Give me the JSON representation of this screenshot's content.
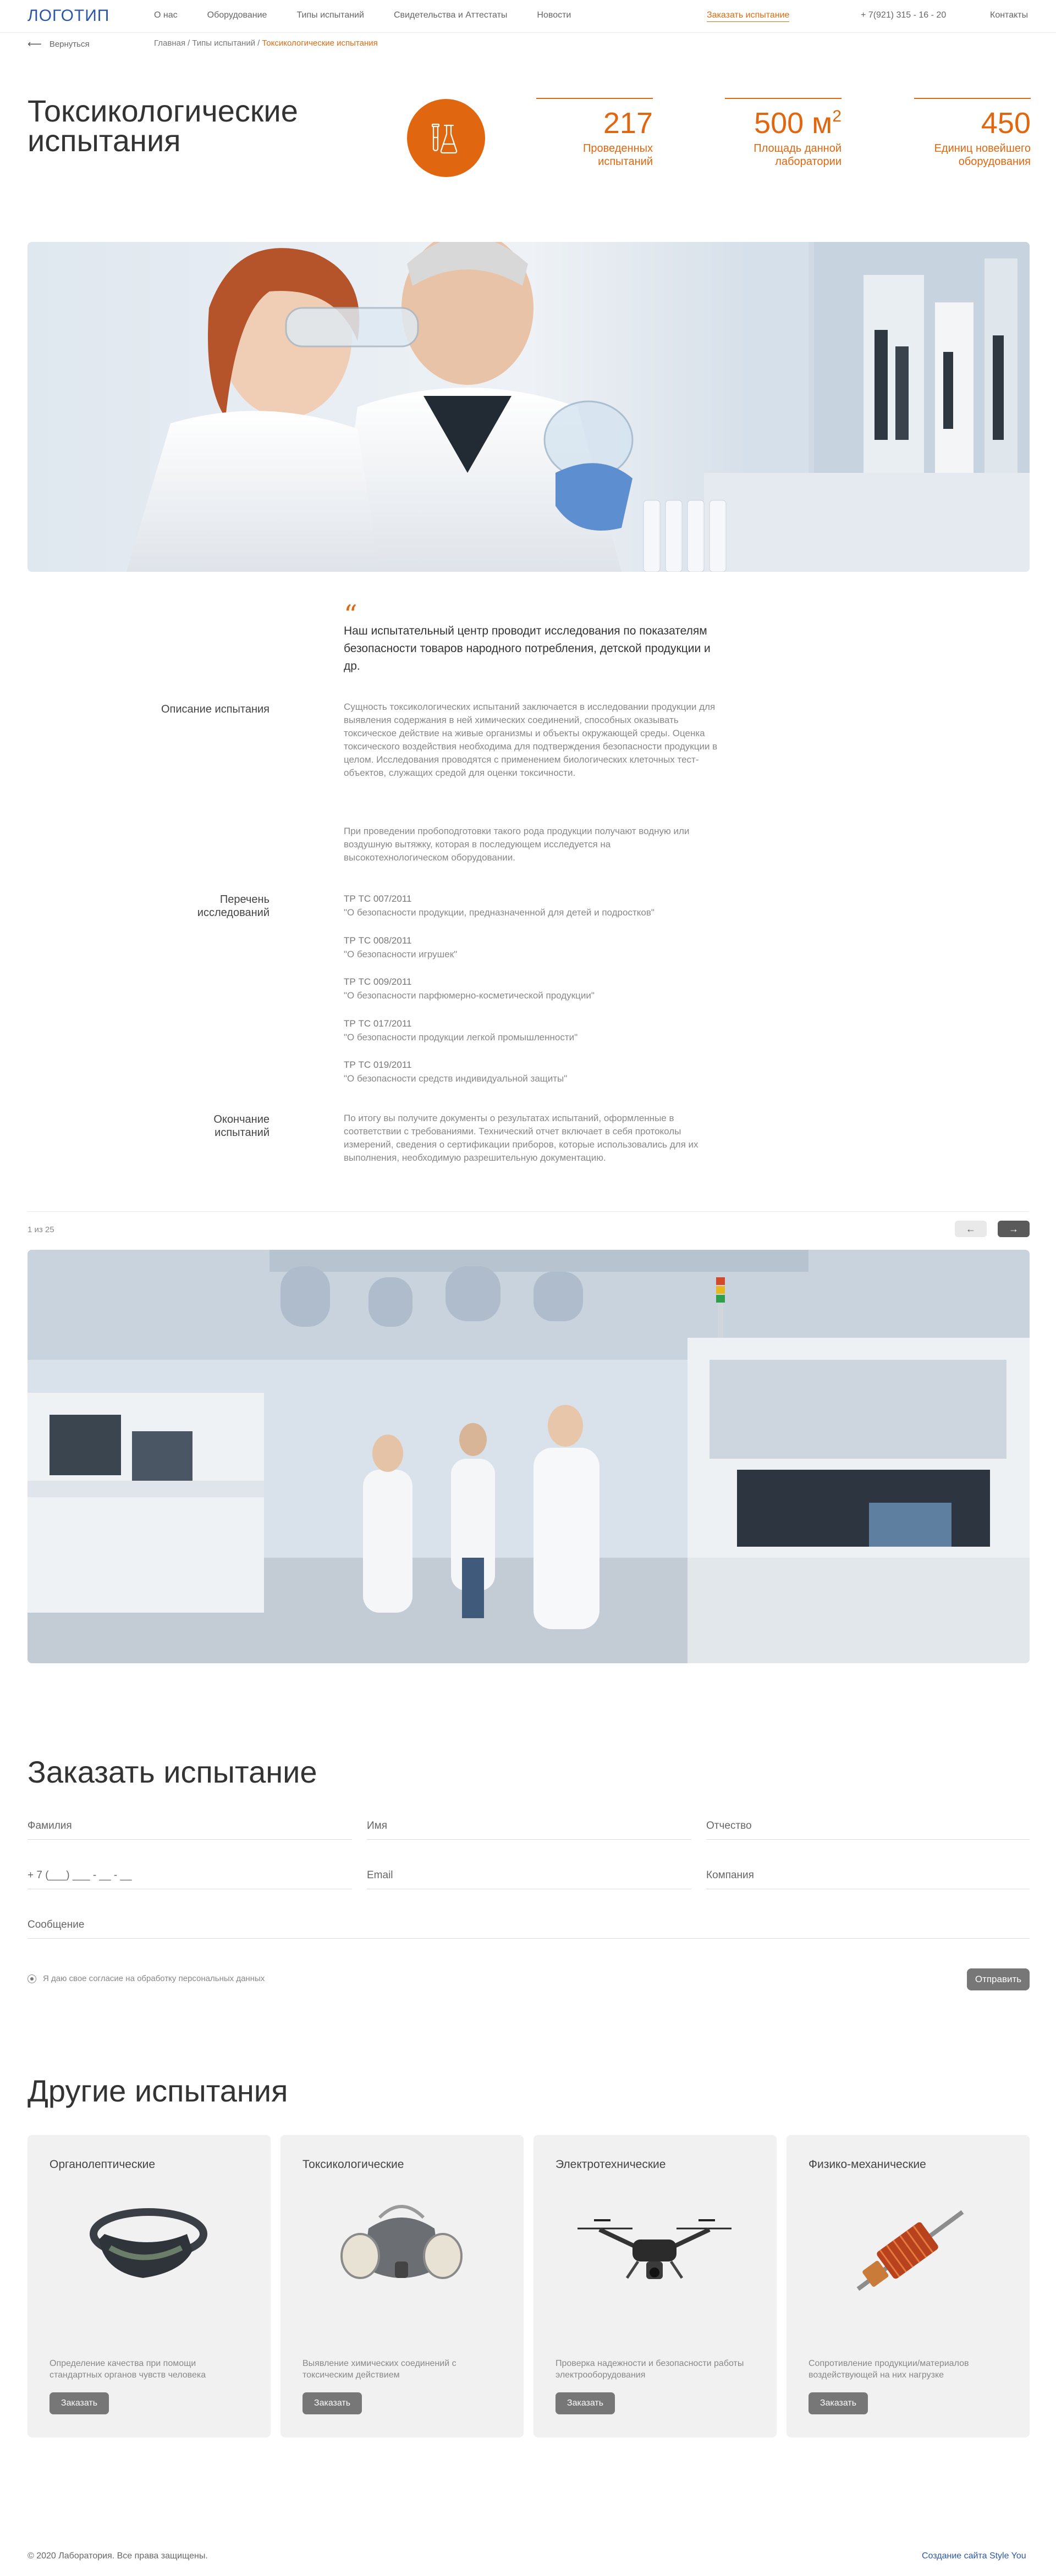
{
  "header": {
    "logo": "ЛОГОТИП",
    "nav": [
      "О нас",
      "Оборудование",
      "Типы испытаний",
      "Свидетельства и Аттестаты",
      "Новости"
    ],
    "order_link": "Заказать испытание",
    "phone": "+ 7(921) 315 - 16 - 20",
    "contacts": "Контакты"
  },
  "subnav": {
    "back": "Вернуться",
    "breadcrumbs": [
      "Главная",
      "Типы испытаний",
      "Токсикологические испытания"
    ]
  },
  "hero": {
    "title": "Токсикологические испытания",
    "stats": [
      {
        "value": "217",
        "unit": "",
        "label": "Проведенных испытаний"
      },
      {
        "value": "500 м",
        "unit": "2",
        "label": "Площадь данной лаборатории"
      },
      {
        "value": "450",
        "unit": "",
        "label": "Единиц новейшего оборудования"
      }
    ]
  },
  "article": {
    "lead": "Наш испытательный центр проводит исследования по показателям безопасности товаров народного потребления, детской продукции и др.",
    "description_label": "Описание испытания",
    "description_p1": "Сущность токсикологических испытаний заключается в исследовании продукции для выявления содержания в ней химических соединений, способных оказывать токсическое действие на живые организмы и объекты окружающей среды. Оценка токсического воздействия необходима для подтверждения безопасности продукции в целом. Исследования проводятся с применением биологических клеточных тест-объектов, служащих средой для оценки токсичности.",
    "description_p2": "При проведении пробоподготовки такого рода продукции получают водную или воздушную вытяжку, которая в последующем исследуется на высокотехнологическом оборудовании.",
    "list_label": "Перечень исследований",
    "norms": [
      {
        "code": "ТР ТС 007/2011",
        "title": "\"О безопасности продукции, предназначенной для детей и подростков\""
      },
      {
        "code": "ТР ТС 008/2011",
        "title": "\"О безопасности игрушек\""
      },
      {
        "code": "ТР ТС 009/2011",
        "title": "\"О безопасности парфюмерно-косметической продукции\""
      },
      {
        "code": "ТР ТС 017/2011",
        "title": "\"О безопасности продукции легкой промышленности\""
      },
      {
        "code": "ТР ТС 019/2011",
        "title": "\"О безопасности средств индивидуальной защиты\""
      }
    ],
    "end_label": "Окончание испытаний",
    "end_text": "По итогу вы получите документы о результатах испытаний, оформленные в соответствии с требованиями. Технический отчет включает в себя протоколы измерений, сведения о сертификации приборов, которые использовались для их выполнения, необходимую разрешительную документацию."
  },
  "slider": {
    "counter": "1 из 25",
    "prev": "←",
    "next": "→"
  },
  "order_form": {
    "title": "Заказать испытание",
    "fields": {
      "surname": "Фамилия",
      "name": "Имя",
      "patronymic": "Отчество",
      "phone": "+ 7 (___) ___ - __ - __",
      "email": "Email",
      "company": "Компания",
      "message": "Сообщение"
    },
    "consent": "Я даю свое согласие на обработку персональных данных",
    "submit": "Отправить"
  },
  "other_tests": {
    "title": "Другие испытания",
    "cards": [
      {
        "title": "Органолептические",
        "desc": "Определение качества при помощи стандартных органов чувств человека",
        "button": "Заказать"
      },
      {
        "title": "Токсикологические",
        "desc": "Выявление химических соединений с токсическим действием",
        "button": "Заказать"
      },
      {
        "title": "Электротехнические",
        "desc": "Проверка надежности и безопасности работы электрооборудования",
        "button": "Заказать"
      },
      {
        "title": "Физико-механические",
        "desc": "Сопротивление продукции/материалов воздействующей на них нагрузке",
        "button": "Заказать"
      }
    ]
  },
  "footer": {
    "copyright": "© 2020 Лаборатория. Все права защищены.",
    "made_by": "Создание сайта Style You"
  },
  "colors": {
    "accent": "#e0670f",
    "brand": "#2b57a8",
    "button": "#777777"
  }
}
